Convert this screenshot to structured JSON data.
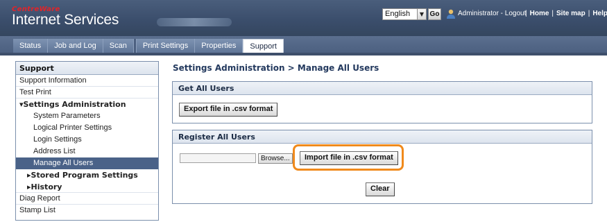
{
  "header": {
    "brand_small": "CentreWare",
    "brand_title": "Internet Services",
    "language_selected": "English",
    "go_label": "Go",
    "user_text": "Administrator - Logout",
    "links": [
      "Home",
      "Site map",
      "Help..."
    ],
    "brand_color": "#e0242a"
  },
  "tabs": [
    {
      "label": "Status"
    },
    {
      "label": "Job and Log"
    },
    {
      "label": "Scan"
    },
    {
      "label": "Print Settings"
    },
    {
      "label": "Properties"
    },
    {
      "label": "Support"
    }
  ],
  "sidebar": {
    "title": "Support",
    "items": [
      {
        "label": "Support Information"
      },
      {
        "label": "Test Print"
      },
      {
        "label": "Settings Administration"
      },
      {
        "label": "System Parameters"
      },
      {
        "label": "Logical Printer Settings"
      },
      {
        "label": "Login Settings"
      },
      {
        "label": "Address List"
      },
      {
        "label": "Manage All Users"
      },
      {
        "label": "Stored Program Settings"
      },
      {
        "label": "History"
      },
      {
        "label": "Diag Report"
      },
      {
        "label": "Stamp List"
      }
    ]
  },
  "main": {
    "page_title": "Settings Administration > Manage All Users",
    "get_panel_title": "Get All Users",
    "export_label": "Export file in .csv format",
    "register_panel_title": "Register All Users",
    "browse_label": "Browse...",
    "import_label": "Import file in .csv format",
    "clear_label": "Clear"
  },
  "colors": {
    "header": "#3b4e6c",
    "selected_item": "#4a6288",
    "highlight": "#f08a1c",
    "title_text": "#23395e"
  }
}
